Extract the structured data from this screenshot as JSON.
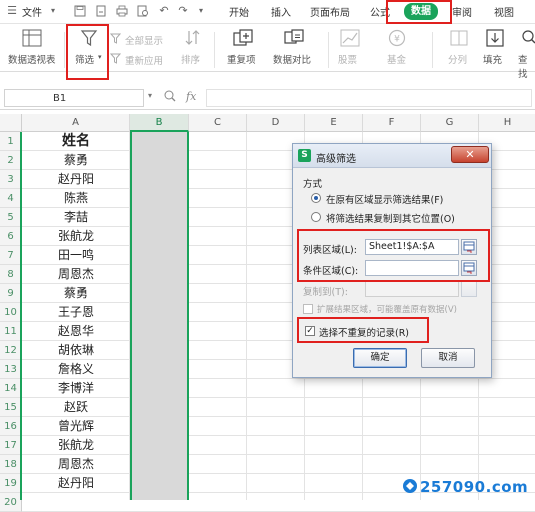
{
  "menubar": {
    "file_label": "文件",
    "tabs": [
      {
        "label": "开始"
      },
      {
        "label": "插入"
      },
      {
        "label": "页面布局"
      },
      {
        "label": "公式"
      },
      {
        "label": "数据"
      },
      {
        "label": "审阅"
      },
      {
        "label": "视图"
      }
    ],
    "active_tab": "数据"
  },
  "toolbar": {
    "pivot": "数据透视表",
    "filter": "筛选",
    "show_all": "全部显示",
    "reapply": "重新应用",
    "sort": "排序",
    "dedupe": "重复项",
    "compare": "数据对比",
    "stock": "股票",
    "fund": "基金",
    "split": "分列",
    "fill": "填充",
    "find": "查找"
  },
  "formula_bar": {
    "name_box": "B1",
    "fx_label": "fx",
    "formula": ""
  },
  "sheet": {
    "columns": [
      "A",
      "B",
      "C",
      "D",
      "E",
      "F",
      "G",
      "H"
    ],
    "selected_column": "B",
    "rows": [
      "1",
      "2",
      "3",
      "4",
      "5",
      "6",
      "7",
      "8",
      "9",
      "10",
      "11",
      "12",
      "13",
      "14",
      "15",
      "16",
      "17",
      "18",
      "19",
      "20"
    ],
    "column_a": [
      "姓名",
      "蔡勇",
      "赵丹阳",
      "陈燕",
      "李喆",
      "张航龙",
      "田一鸣",
      "周恩杰",
      "蔡勇",
      "王子恩",
      "赵恩华",
      "胡依琳",
      "詹格义",
      "李博洋",
      "赵跃",
      "曾光辉",
      "张航龙",
      "周恩杰",
      "赵丹阳"
    ]
  },
  "dialog": {
    "title": "高级筛选",
    "close": "✕",
    "method_label": "方式",
    "option_inplace": "在原有区域显示筛选结果(F)",
    "option_copy": "将筛选结果复制到其它位置(O)",
    "list_range_label": "列表区域(L):",
    "list_range_value": "Sheet1!$A:$A",
    "criteria_range_label": "条件区域(C):",
    "criteria_range_value": "",
    "copy_to_label": "复制到(T):",
    "copy_to_value": "",
    "extend_label": "扩展结果区域，可能覆盖原有数据(V)",
    "unique_label": "选择不重复的记录(R)",
    "unique_checked": true,
    "ok": "确定",
    "cancel": "取消"
  },
  "watermark": {
    "text": "257090.com"
  },
  "colors": {
    "accent": "#1aa35b",
    "highlight": "#e0201e",
    "selected_column_fill": "#d9d9d9"
  }
}
